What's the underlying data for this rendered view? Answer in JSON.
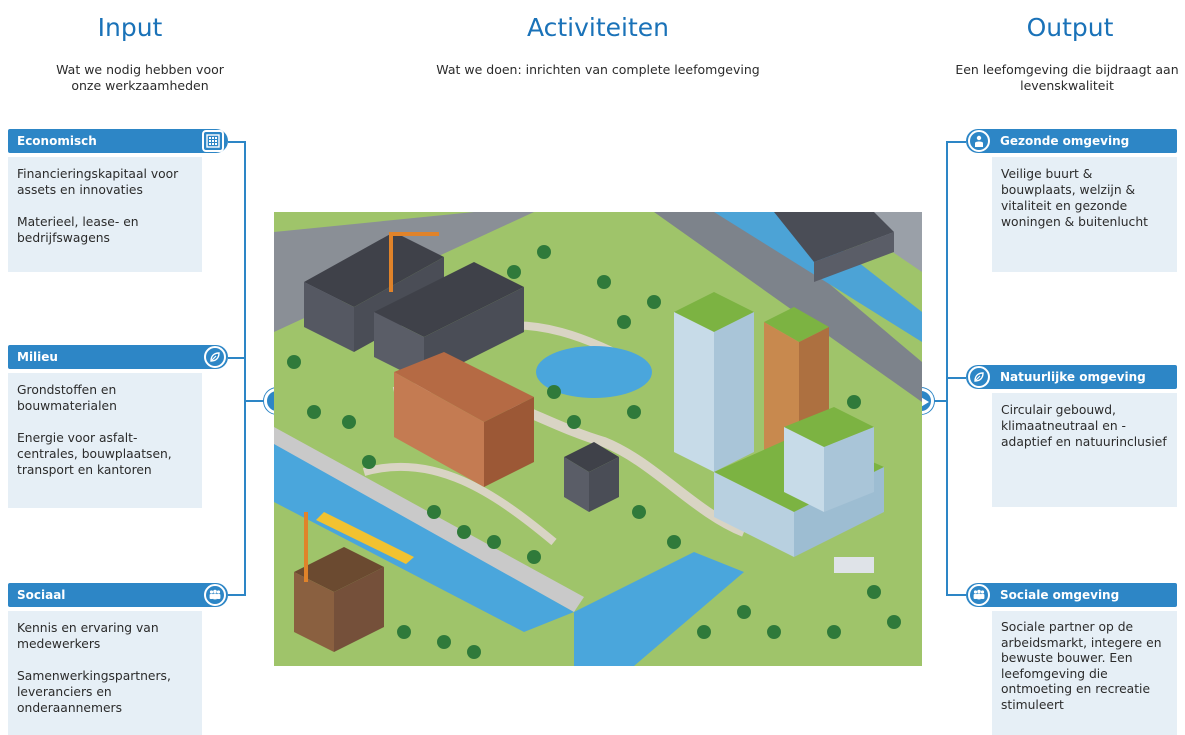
{
  "input": {
    "title": "Input",
    "subtitle": "Wat we nodig hebben voor onze werkzaamheden",
    "cards": [
      {
        "title": "Economisch",
        "icon": "building-icon",
        "lines": [
          "Financieringskapitaal voor assets en innovaties",
          "Materieel, lease- en bedrijfswagens"
        ]
      },
      {
        "title": "Milieu",
        "icon": "leaf-icon",
        "lines": [
          "Grondstoffen en bouwmaterialen",
          "Energie voor asfalt-centrales, bouwplaatsen, transport en kantoren"
        ]
      },
      {
        "title": "Sociaal",
        "icon": "people-icon",
        "lines": [
          "Kennis en ervaring van medewerkers",
          "Samenwerkingspartners, leveranciers en onderaannemers"
        ]
      }
    ]
  },
  "activities": {
    "title": "Activiteiten",
    "subtitle": "Wat we doen: inrichten van complete leefomgeving"
  },
  "output": {
    "title": "Output",
    "subtitle": "Een leefomgeving die bijdraagt aan levenskwaliteit",
    "cards": [
      {
        "title": "Gezonde omgeving",
        "icon": "person-icon",
        "lines": [
          "Veilige buurt & bouwplaats, welzijn & vitaliteit en gezonde woningen & buitenlucht"
        ]
      },
      {
        "title": "Natuurlijke omgeving",
        "icon": "leaf-icon",
        "lines": [
          "Circulair gebouwd, klimaatneutraal en -adaptief en natuurinclusief"
        ]
      },
      {
        "title": "Sociale omgeving",
        "icon": "people-icon",
        "lines": [
          "Sociale partner op de arbeidsmarkt, integere en bewuste bouwer. Een leefomgeving die ontmoeting en recreatie stimuleert"
        ]
      }
    ]
  },
  "colors": {
    "accent": "#2d86c6",
    "title": "#1a72b8",
    "card_bg": "#e6eff6"
  }
}
